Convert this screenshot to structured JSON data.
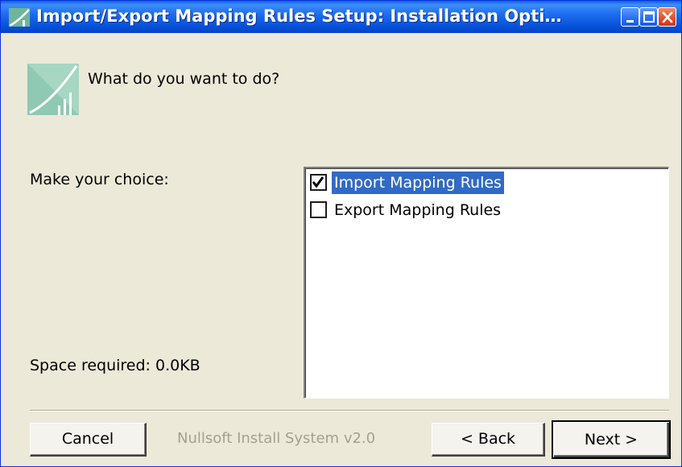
{
  "window": {
    "title": "Import/Export Mapping Rules Setup: Installation Opti…",
    "icon": "installer-chart-icon",
    "controls": [
      "minimize-icon",
      "maximize-icon",
      "close-icon"
    ]
  },
  "header": {
    "question": "What do you want to do?",
    "logo": "installer-chart-logo"
  },
  "left_panel": {
    "choice_label": "Make your choice:",
    "space_label": "Space required: 0.0KB"
  },
  "components": [
    {
      "label": "Import Mapping Rules",
      "checked": true,
      "selected": true
    },
    {
      "label": "Export Mapping Rules",
      "checked": false,
      "selected": false
    }
  ],
  "footer": {
    "branding": "Nullsoft Install System v2.0",
    "cancel_label": "Cancel",
    "back_label": "< Back",
    "next_label": "Next >"
  },
  "colors": {
    "titlebar": "#0551d8",
    "selection": "#316ac5",
    "dialog_bg": "#ece9d8",
    "logo_green": "#8fc9b3"
  }
}
